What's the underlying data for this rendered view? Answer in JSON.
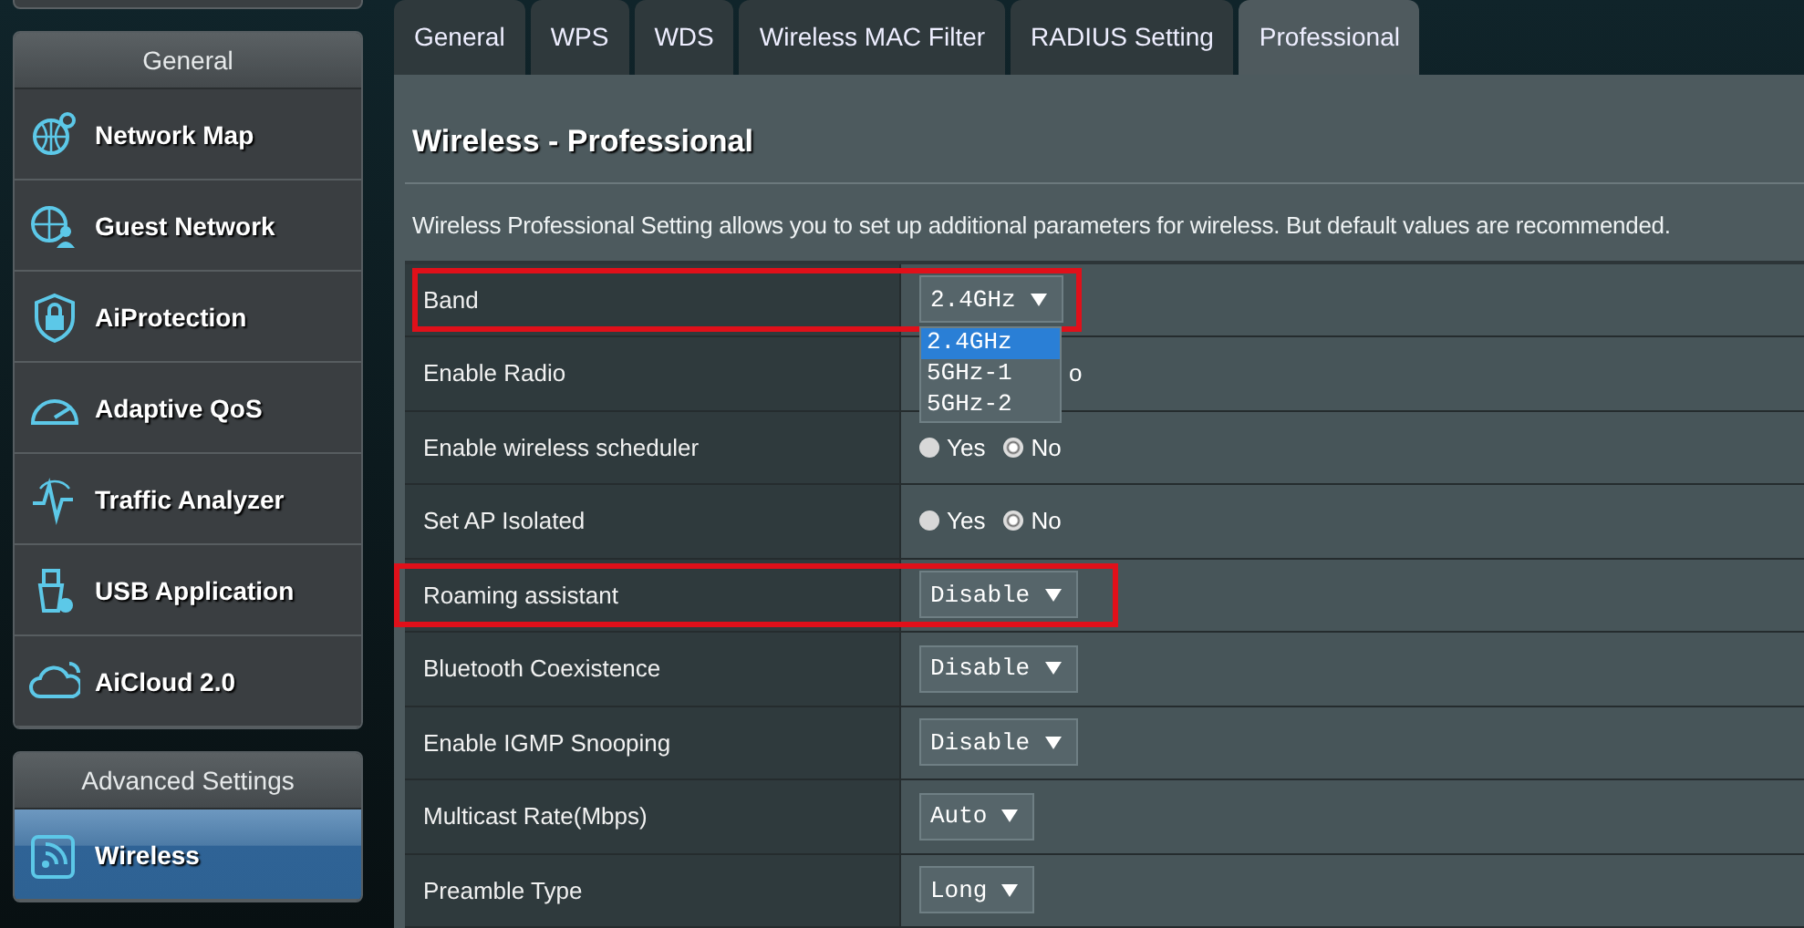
{
  "sidebar": {
    "sections": [
      {
        "title": "General",
        "items": [
          {
            "label": "Network Map",
            "selected": false
          },
          {
            "label": "Guest Network",
            "selected": false
          },
          {
            "label": "AiProtection",
            "selected": false
          },
          {
            "label": "Adaptive QoS",
            "selected": false
          },
          {
            "label": "Traffic Analyzer",
            "selected": false
          },
          {
            "label": "USB Application",
            "selected": false
          },
          {
            "label": "AiCloud 2.0",
            "selected": false
          }
        ]
      },
      {
        "title": "Advanced Settings",
        "items": [
          {
            "label": "Wireless",
            "selected": true
          }
        ]
      }
    ]
  },
  "tabs": [
    {
      "label": "General",
      "selected": false
    },
    {
      "label": "WPS",
      "selected": false
    },
    {
      "label": "WDS",
      "selected": false
    },
    {
      "label": "Wireless MAC Filter",
      "selected": false
    },
    {
      "label": "RADIUS Setting",
      "selected": false
    },
    {
      "label": "Professional",
      "selected": true
    }
  ],
  "page": {
    "title": "Wireless - Professional",
    "description": "Wireless Professional Setting allows you to set up additional parameters for wireless. But default values are recommended."
  },
  "settings": [
    {
      "label": "Band",
      "kind": "select",
      "value": "2.4GHz",
      "highlighted": true,
      "options": [
        {
          "label": "2.4GHz",
          "selected": true
        },
        {
          "label": "5GHz-1",
          "selected": false
        },
        {
          "label": "5GHz-2",
          "selected": false
        }
      ]
    },
    {
      "label": "Enable Radio",
      "kind": "covered",
      "value": "o",
      "highlighted": false
    },
    {
      "label": "Enable wireless scheduler",
      "kind": "radio",
      "highlighted": false,
      "options": [
        {
          "label": "Yes",
          "selected": false
        },
        {
          "label": "No",
          "selected": true
        }
      ]
    },
    {
      "label": "Set AP Isolated",
      "kind": "radio",
      "highlighted": false,
      "options": [
        {
          "label": "Yes",
          "selected": false
        },
        {
          "label": "No",
          "selected": true
        }
      ]
    },
    {
      "label": "Roaming assistant",
      "kind": "select",
      "value": "Disable",
      "highlighted": true
    },
    {
      "label": "Bluetooth Coexistence",
      "kind": "select",
      "value": "Disable",
      "highlighted": false
    },
    {
      "label": "Enable IGMP Snooping",
      "kind": "select",
      "value": "Disable",
      "highlighted": false
    },
    {
      "label": "Multicast Rate(Mbps)",
      "kind": "select",
      "value": "Auto",
      "highlighted": false
    },
    {
      "label": "Preamble Type",
      "kind": "select",
      "value": "Long",
      "highlighted": false
    }
  ]
}
